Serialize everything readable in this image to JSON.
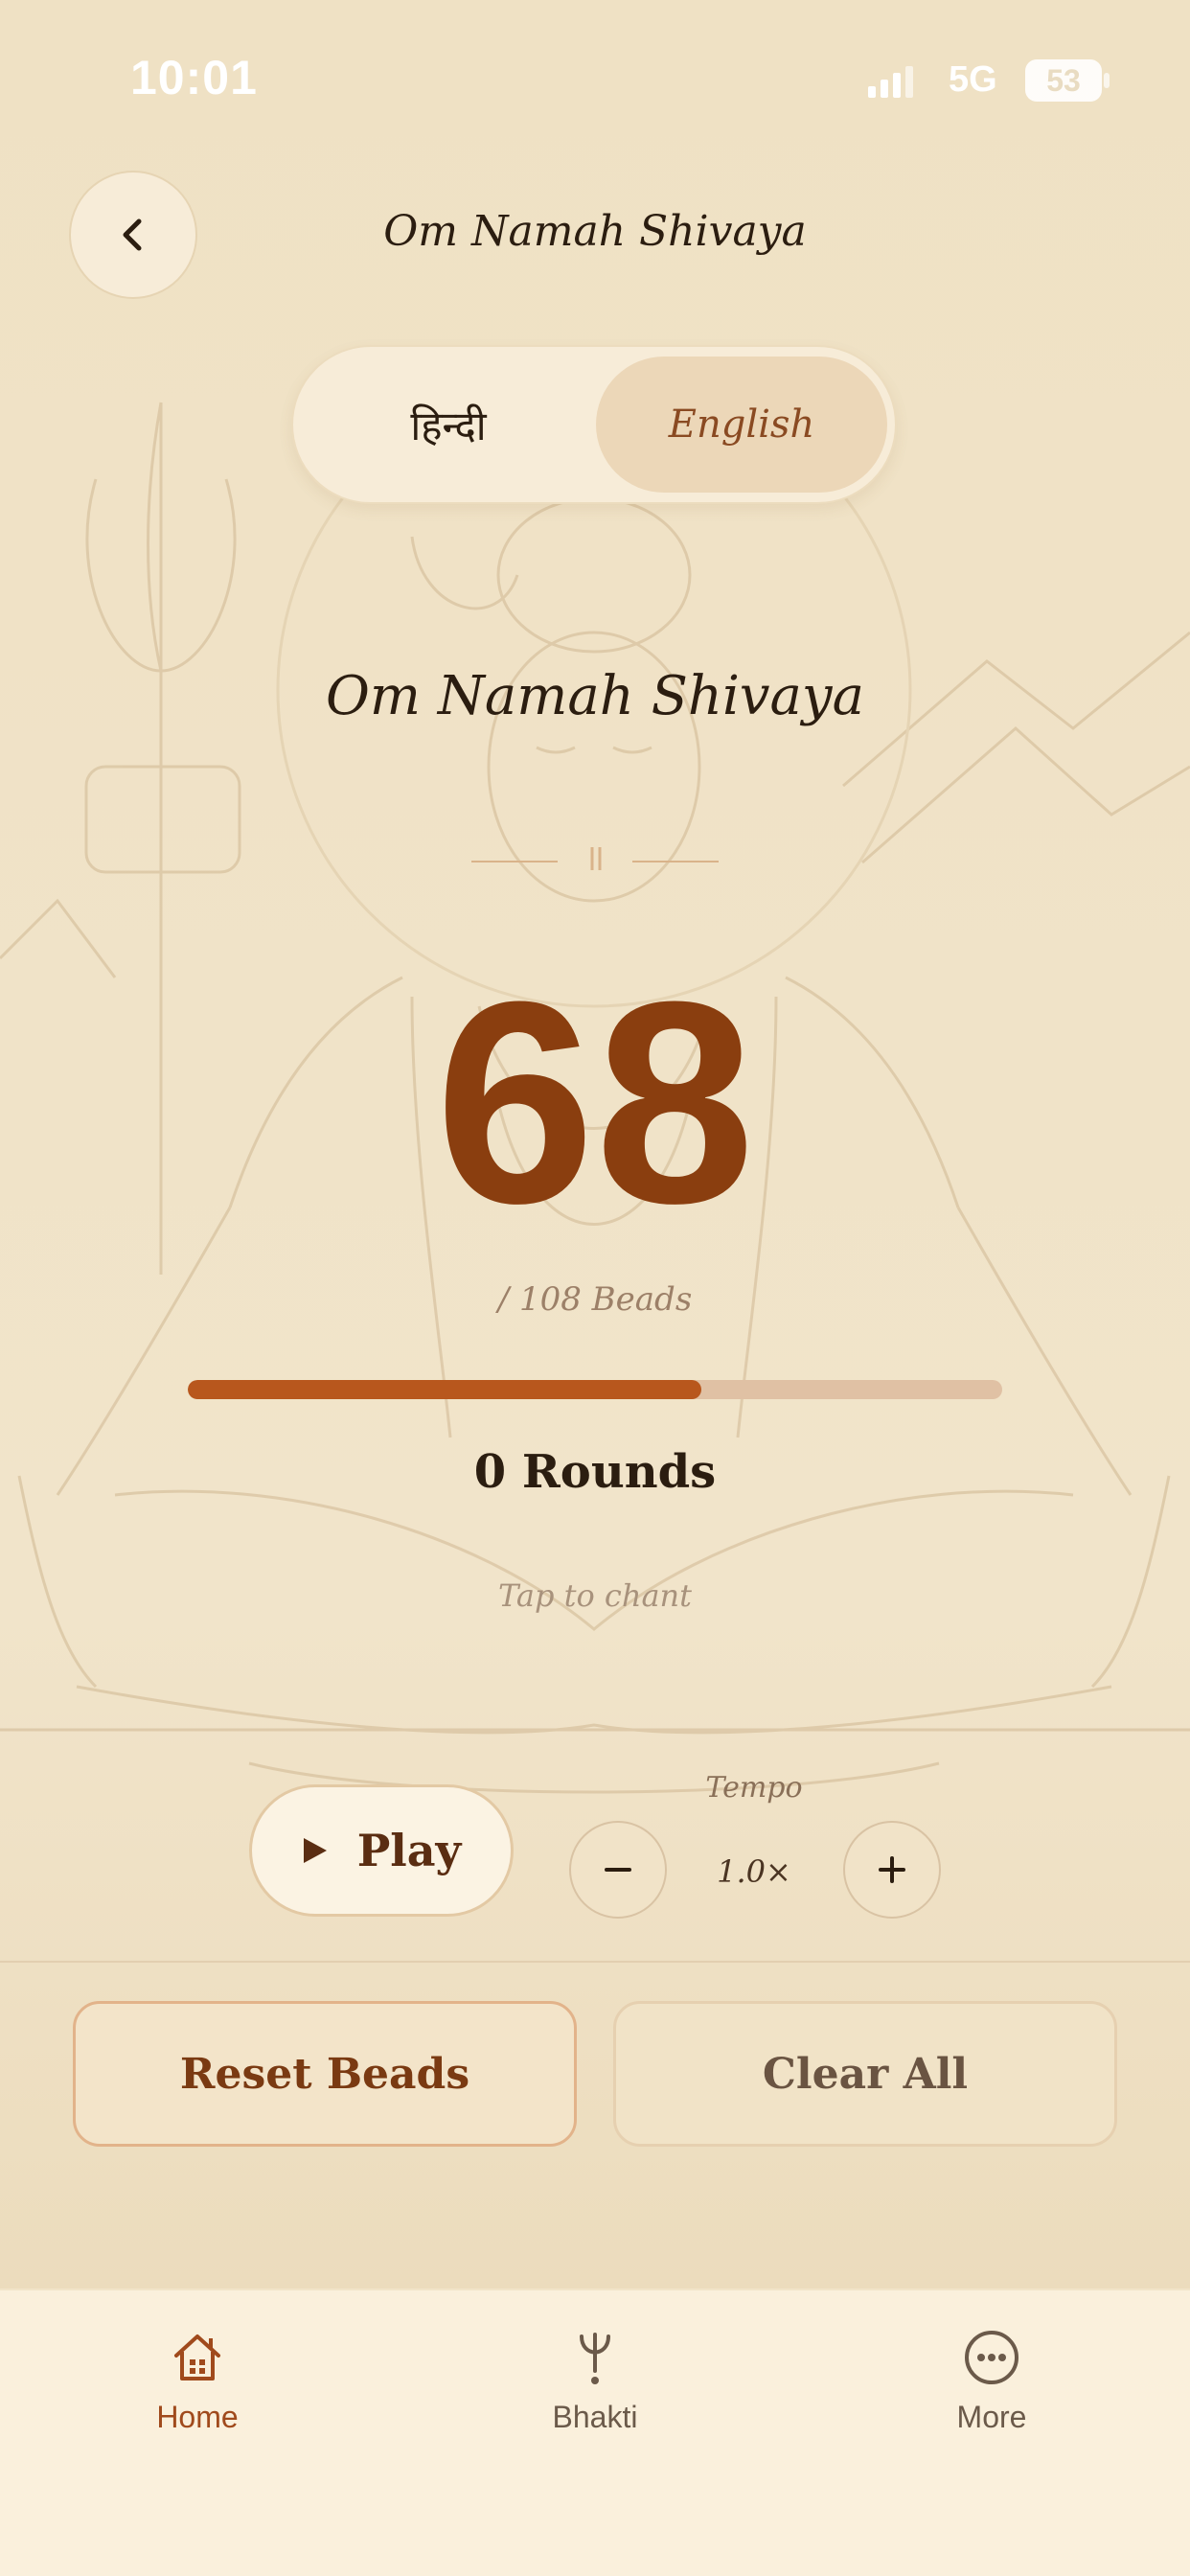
{
  "status_bar": {
    "time": "10:01",
    "network": "5G",
    "battery": "53"
  },
  "header": {
    "title": "Om Namah Shivaya",
    "back_icon": "chevron-left-icon"
  },
  "language_toggle": {
    "options": [
      "हिन्दी",
      "English"
    ],
    "selected": "English"
  },
  "mantra": {
    "title": "Om Namah Shivaya"
  },
  "counter": {
    "count": "68",
    "beads_label": "/ 108 Beads",
    "total_beads": 108,
    "progress_fraction": 0.63,
    "rounds": "0 Rounds",
    "hint": "Tap to chant"
  },
  "controls": {
    "play_label": "Play",
    "play_icon": "play-icon",
    "tempo_label": "Tempo",
    "tempo_value": "1.0×",
    "minus_icon": "minus-icon",
    "plus_icon": "plus-icon"
  },
  "actions": {
    "reset_label": "Reset Beads",
    "clear_label": "Clear All"
  },
  "tab_bar": {
    "items": [
      {
        "label": "Home",
        "icon": "home-icon",
        "active": true
      },
      {
        "label": "Bhakti",
        "icon": "trident-icon",
        "active": false
      },
      {
        "label": "More",
        "icon": "more-icon",
        "active": false
      }
    ]
  },
  "colors": {
    "accent": "#8a3e0f",
    "progress": "#b8571d",
    "background": "#f1e4c9",
    "active_tab": "#a04a1c",
    "inactive_tab": "#6b5a4a"
  }
}
